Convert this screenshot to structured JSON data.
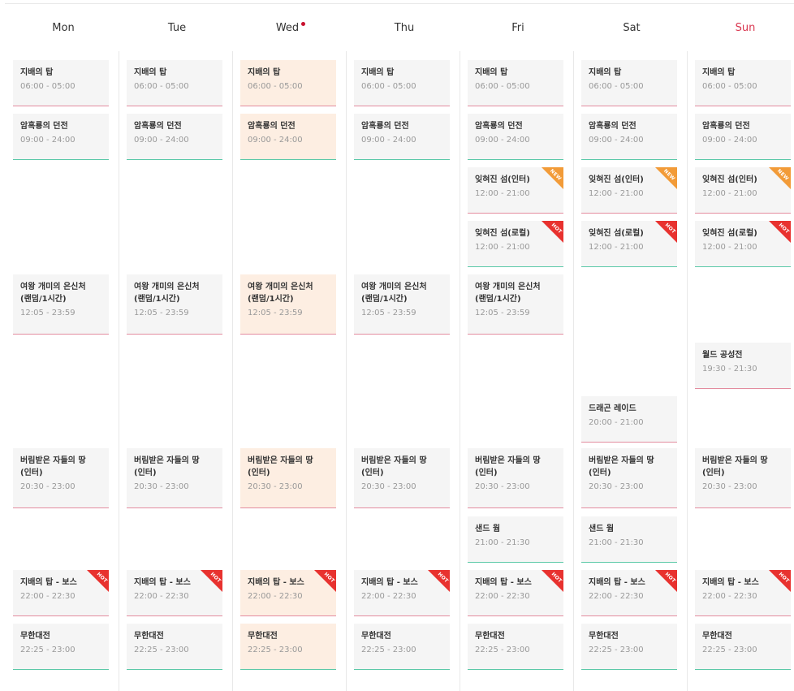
{
  "days": [
    {
      "label": "Mon",
      "sunday": false,
      "today": false
    },
    {
      "label": "Tue",
      "sunday": false,
      "today": false
    },
    {
      "label": "Wed",
      "sunday": false,
      "today": true
    },
    {
      "label": "Thu",
      "sunday": false,
      "today": false
    },
    {
      "label": "Fri",
      "sunday": false,
      "today": false
    },
    {
      "label": "Sat",
      "sunday": false,
      "today": false
    },
    {
      "label": "Sun",
      "sunday": true,
      "today": false
    }
  ],
  "badge_labels": {
    "hot": "HOT",
    "new": "NEW"
  },
  "rows": [
    {
      "title": "지배의 탑",
      "time": "06:00 - 05:00",
      "color": "red",
      "badge": "",
      "days": [
        0,
        1,
        2,
        3,
        4,
        5,
        6
      ]
    },
    {
      "title": "암흑룡의 던전",
      "time": "09:00 - 24:00",
      "color": "green",
      "badge": "",
      "days": [
        0,
        1,
        2,
        3,
        4,
        5,
        6
      ]
    },
    {
      "title": "잊혀진 섬(인터)",
      "time": "12:00 - 21:00",
      "color": "red",
      "badge": "new",
      "days": [
        4,
        5,
        6
      ]
    },
    {
      "title": "잊혀진 섬(로컬)",
      "time": "12:00 - 21:00",
      "color": "green",
      "badge": "hot",
      "days": [
        4,
        5,
        6
      ]
    },
    {
      "title": "여왕 개미의 은신처\n(랜덤/1시간)",
      "time": "12:05 - 23:59",
      "color": "red",
      "badge": "",
      "days": [
        0,
        1,
        2,
        3,
        4
      ]
    },
    {
      "title": "월드 공성전",
      "time": "19:30 - 21:30",
      "color": "red",
      "badge": "",
      "days": [
        6
      ]
    },
    {
      "title": "드래곤 레이드",
      "time": "20:00 - 21:00",
      "color": "red",
      "badge": "",
      "days": [
        5
      ]
    },
    {
      "title": "버림받은 자들의 땅\n(인터)",
      "time": "20:30 - 23:00",
      "color": "red",
      "badge": "",
      "days": [
        0,
        1,
        2,
        3,
        4,
        5,
        6
      ]
    },
    {
      "title": "샌드 웜",
      "time": "21:00 - 21:30",
      "color": "green",
      "badge": "",
      "days": [
        4,
        5
      ]
    },
    {
      "title": "지배의 탑 - 보스",
      "time": "22:00 - 22:30",
      "color": "red",
      "badge": "hot",
      "days": [
        0,
        1,
        2,
        3,
        4,
        5,
        6
      ]
    },
    {
      "title": "무한대전",
      "time": "22:25 - 23:00",
      "color": "green",
      "badge": "",
      "days": [
        0,
        1,
        2,
        3,
        4,
        5,
        6
      ]
    }
  ]
}
